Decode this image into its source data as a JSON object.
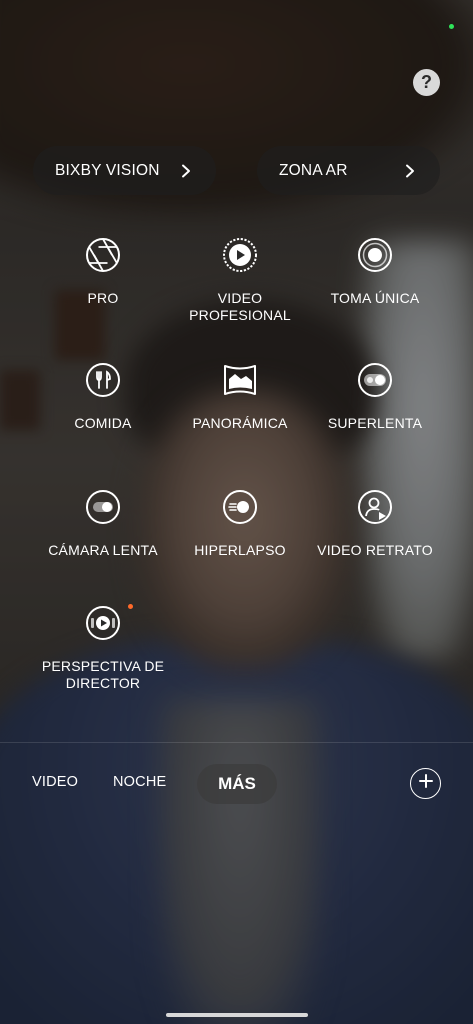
{
  "help_button": {
    "label": "?"
  },
  "shortcuts": [
    {
      "label": "BIXBY VISION",
      "icon": "chevron-right-icon"
    },
    {
      "label": "ZONA AR",
      "icon": "chevron-right-icon"
    }
  ],
  "modes": [
    {
      "label": "PRO",
      "icon": "aperture-icon"
    },
    {
      "label": "VIDEO\nPROFESIONAL",
      "icon": "video-play-icon"
    },
    {
      "label": "TOMA ÚNICA",
      "icon": "single-take-icon"
    },
    {
      "label": "COMIDA",
      "icon": "fork-knife-icon"
    },
    {
      "label": "PANORÁMICA",
      "icon": "panorama-icon"
    },
    {
      "label": "SUPERLENTA",
      "icon": "super-slow-icon"
    },
    {
      "label": "CÁMARA LENTA",
      "icon": "slow-motion-icon"
    },
    {
      "label": "HIPERLAPSO",
      "icon": "hyperlapse-icon"
    },
    {
      "label": "VIDEO RETRATO",
      "icon": "portrait-video-icon"
    },
    {
      "label": "PERSPECTIVA DE\nDIRECTOR",
      "icon": "directors-view-icon"
    }
  ],
  "bottom_bar": {
    "modes": [
      "VIDEO",
      "NOCHE"
    ],
    "active_mode": "MÁS",
    "add_icon": "plus-icon"
  },
  "colors": {
    "status_dot": "#2fe35a",
    "new_badge": "#ff6a2a"
  }
}
